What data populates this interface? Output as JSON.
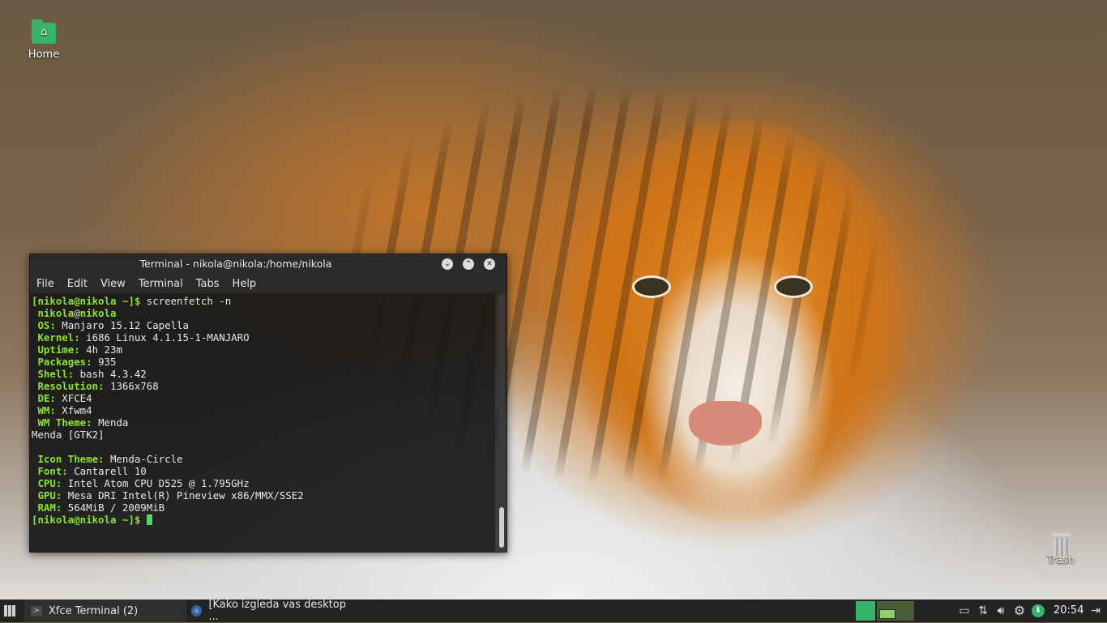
{
  "desktop": {
    "home_label": "Home",
    "trash_label": "Trash"
  },
  "terminal": {
    "title": "Terminal - nikola@nikola:/home/nikola",
    "menu": [
      "File",
      "Edit",
      "View",
      "Terminal",
      "Tabs",
      "Help"
    ],
    "lines": [
      {
        "label": "[nikola@nikola ~]$",
        "value": " screenfetch -n"
      },
      {
        "label": " nikola",
        "value": "@",
        "label2": "nikola"
      },
      {
        "label": " OS:",
        "value": " Manjaro 15.12 Capella"
      },
      {
        "label": " Kernel:",
        "value": " i686 Linux 4.1.15-1-MANJARO"
      },
      {
        "label": " Uptime:",
        "value": " 4h 23m"
      },
      {
        "label": " Packages:",
        "value": " 935"
      },
      {
        "label": " Shell:",
        "value": " bash 4.3.42"
      },
      {
        "label": " Resolution:",
        "value": " 1366x768"
      },
      {
        "label": " DE:",
        "value": " XFCE4"
      },
      {
        "label": " WM:",
        "value": " Xfwm4"
      },
      {
        "label": " WM Theme:",
        "value": " Menda"
      },
      {
        "label": "",
        "value": "Menda [GTK2]"
      },
      {
        "label": "",
        "value": ""
      },
      {
        "label": " Icon Theme:",
        "value": " Menda-Circle"
      },
      {
        "label": " Font:",
        "value": " Cantarell 10"
      },
      {
        "label": " CPU:",
        "value": " Intel Atom CPU D525 @ 1.795GHz"
      },
      {
        "label": " GPU:",
        "value": " Mesa DRI Intel(R) Pineview x86/MMX/SSE2"
      },
      {
        "label": " RAM:",
        "value": " 564MiB / 2009MiB"
      },
      {
        "label": "[nikola@nikola ~]$",
        "value": " "
      }
    ]
  },
  "taskbar": {
    "task1": "Xfce Terminal (2)",
    "task2": "[Kako izgleda vas desktop ...",
    "clock": "20:54"
  },
  "colors": {
    "accent_green": "#36b46b",
    "terminal_green": "#8ae234"
  }
}
